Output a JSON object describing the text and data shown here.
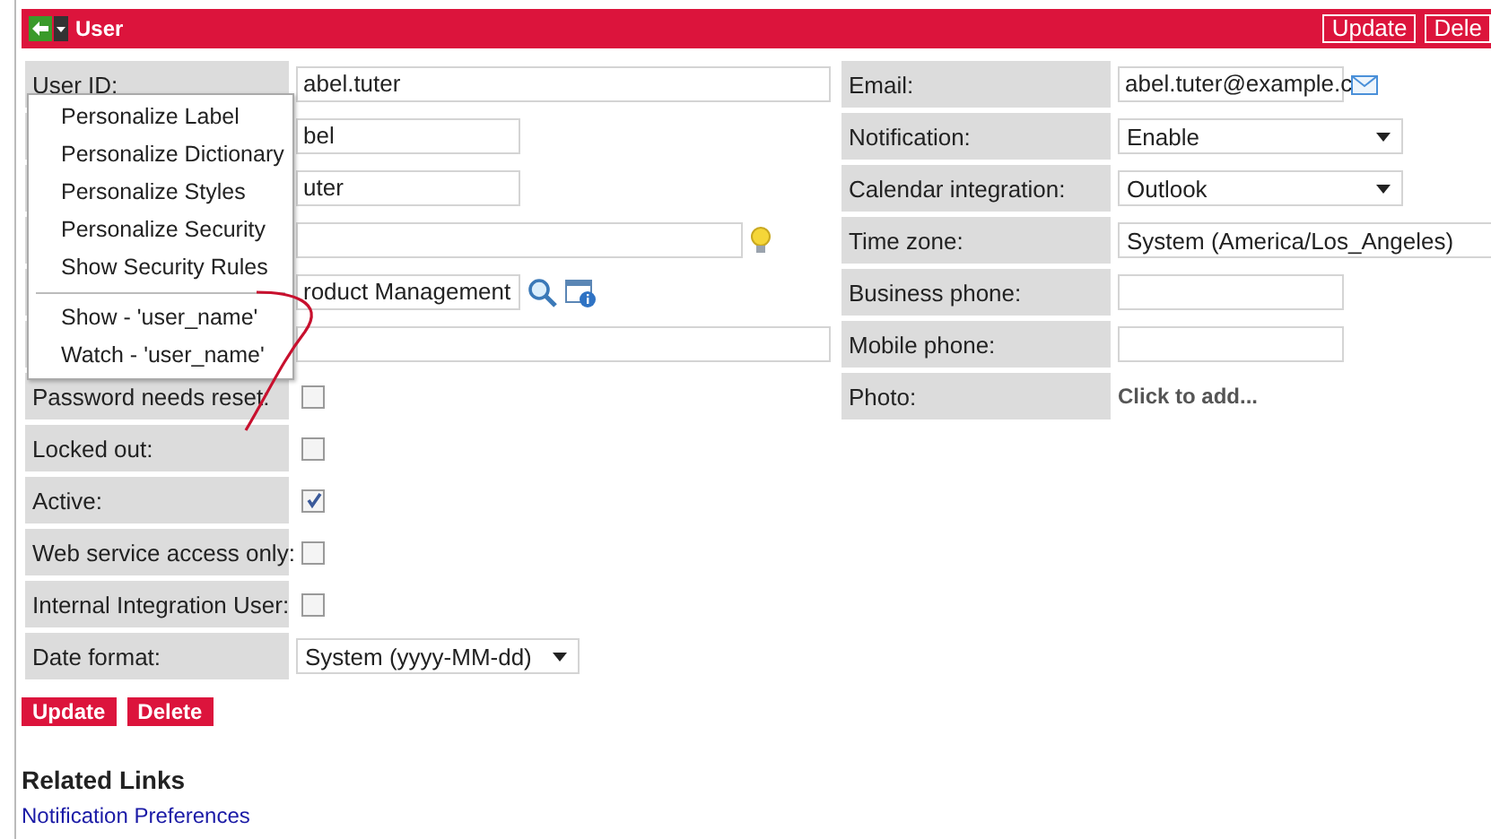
{
  "header": {
    "title": "User",
    "buttons": [
      "Update",
      "Dele"
    ]
  },
  "left_fields": [
    {
      "label": "User ID:",
      "kind": "text",
      "value": "abel.tuter"
    },
    {
      "kind": "text",
      "value": "bel"
    },
    {
      "kind": "text",
      "value": "uter"
    },
    {
      "kind": "hint"
    },
    {
      "kind": "lookup",
      "value": "roduct Management"
    },
    {
      "kind": "text"
    },
    {
      "label": "Password needs reset:",
      "kind": "checkbox",
      "checked": false
    },
    {
      "label": "Locked out:",
      "kind": "checkbox",
      "checked": false
    },
    {
      "label": "Active:",
      "kind": "checkbox",
      "checked": true
    },
    {
      "label": "Web service access only:",
      "kind": "checkbox",
      "checked": false
    },
    {
      "label": "Internal Integration User:",
      "kind": "checkbox",
      "checked": false
    },
    {
      "label": "Date format:",
      "kind": "select",
      "value": "System (yyyy-MM-dd)"
    }
  ],
  "right_fields": [
    {
      "label": "Email:",
      "kind": "email",
      "value": "abel.tuter@example.c"
    },
    {
      "label": "Notification:",
      "kind": "select",
      "value": "Enable"
    },
    {
      "label": "Calendar integration:",
      "kind": "select",
      "value": "Outlook"
    },
    {
      "label": "Time zone:",
      "kind": "wide-select",
      "value": "System (America/Los_Angeles)"
    },
    {
      "label": "Business phone:",
      "kind": "text"
    },
    {
      "label": "Mobile phone:",
      "kind": "text"
    },
    {
      "label": "Photo:",
      "kind": "static",
      "value": "Click to add..."
    }
  ],
  "context_menu": {
    "groups": [
      [
        "Personalize Label",
        "Personalize Dictionary",
        "Personalize Styles",
        "Personalize Security",
        "Show Security Rules"
      ],
      [
        "Show - 'user_name'",
        "Watch - 'user_name'"
      ]
    ]
  },
  "buttons": [
    "Update",
    "Delete"
  ],
  "related_links": {
    "title": "Related Links",
    "links": [
      "Notification Preferences"
    ]
  }
}
